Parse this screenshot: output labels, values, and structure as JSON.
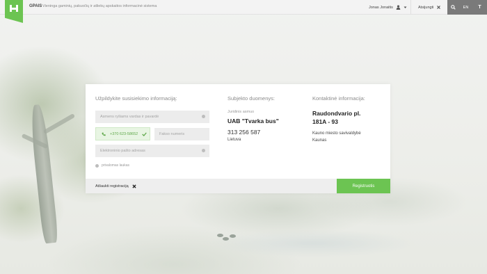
{
  "header": {
    "app_name": "GPAIS",
    "app_description": "Vieninga gaminių, pakuočių ir atliekų apskaitos informacinė sistema",
    "user_name": "Jonas Jonaitis",
    "logout_label": "Atsijungti",
    "lang_label": "EN",
    "font_label": "T",
    "accent_color": "#6cc452"
  },
  "form": {
    "title": "Užpildykite susisiekimo informaciją:",
    "name_placeholder": "Asmens ryšiams vardas ir pavardė",
    "phone_value": "+370 623-58652",
    "fax_placeholder": "Fakso numeris",
    "email_placeholder": "Elektroninio pašto adresas",
    "required_note": "privalomas laukas"
  },
  "subject": {
    "title": "Subjekto duomenys:",
    "type": "Juridinis asmuo",
    "name": "UAB \"Tvarka bus\"",
    "phone": "313 256 587",
    "country": "Lietuva"
  },
  "contact": {
    "title": "Kontaktinė informacija:",
    "address_line1": "Raudondvario pl.",
    "address_line2": "181A - 93",
    "municipality": "Kauno miesto savivaldybė",
    "city": "Kaunas"
  },
  "footer": {
    "cancel_label": "Atšaukti registraciją",
    "register_label": "Registruotis"
  }
}
